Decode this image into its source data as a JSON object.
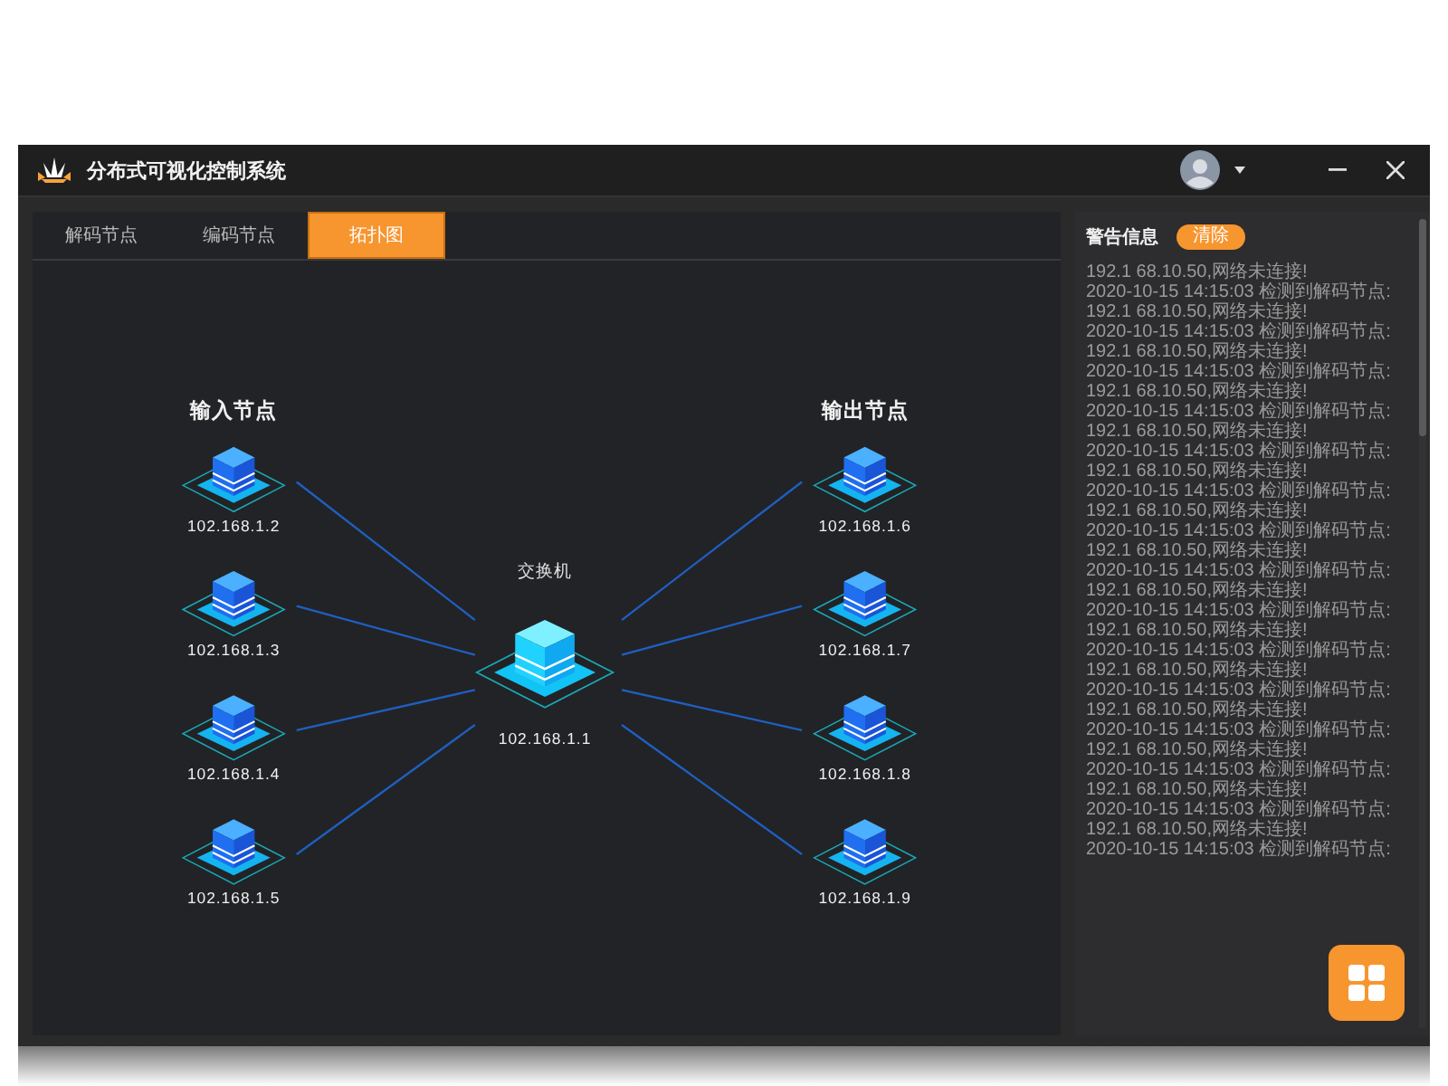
{
  "window": {
    "title": "分布式可视化控制系统"
  },
  "tabs": [
    {
      "label": "解码节点",
      "selected": false
    },
    {
      "label": "编码节点",
      "selected": false
    },
    {
      "label": "拓扑图",
      "selected": true
    }
  ],
  "topology": {
    "input_title": "输入节点",
    "output_title": "输出节点",
    "switch": {
      "label": "交换机",
      "ip": "102.168.1.1"
    },
    "inputs": [
      {
        "ip": "102.168.1.2"
      },
      {
        "ip": "102.168.1.3"
      },
      {
        "ip": "102.168.1.4"
      },
      {
        "ip": "102.168.1.5"
      }
    ],
    "outputs": [
      {
        "ip": "102.168.1.6"
      },
      {
        "ip": "102.168.1.7"
      },
      {
        "ip": "102.168.1.8"
      },
      {
        "ip": "102.168.1.9"
      }
    ]
  },
  "alerts": {
    "title": "警告信息",
    "clear_button": "清除",
    "lines": [
      "192.1 68.10.50,网络未连接!",
      "2020-10-15 14:15:03 检测到解码节点:",
      "192.1 68.10.50,网络未连接!",
      "2020-10-15 14:15:03 检测到解码节点:",
      "192.1 68.10.50,网络未连接!",
      "2020-10-15 14:15:03 检测到解码节点:",
      "192.1 68.10.50,网络未连接!",
      "2020-10-15 14:15:03 检测到解码节点:",
      "192.1 68.10.50,网络未连接!",
      "2020-10-15 14:15:03 检测到解码节点:",
      "192.1 68.10.50,网络未连接!",
      "2020-10-15 14:15:03 检测到解码节点:",
      "192.1 68.10.50,网络未连接!",
      "2020-10-15 14:15:03 检测到解码节点:",
      "192.1 68.10.50,网络未连接!",
      "2020-10-15 14:15:03 检测到解码节点:",
      "192.1 68.10.50,网络未连接!",
      "2020-10-15 14:15:03 检测到解码节点:",
      "192.1 68.10.50,网络未连接!",
      "2020-10-15 14:15:03 检测到解码节点:",
      "192.1 68.10.50,网络未连接!",
      "2020-10-15 14:15:03 检测到解码节点:",
      "192.1 68.10.50,网络未连接!",
      "2020-10-15 14:15:03 检测到解码节点:",
      "192.1 68.10.50,网络未连接!",
      "2020-10-15 14:15:03 检测到解码节点:",
      "192.1 68.10.50,网络未连接!",
      "2020-10-15 14:15:03 检测到解码节点:",
      "192.1 68.10.50,网络未连接!",
      "2020-10-15 14:15:03 检测到解码节点:"
    ]
  }
}
